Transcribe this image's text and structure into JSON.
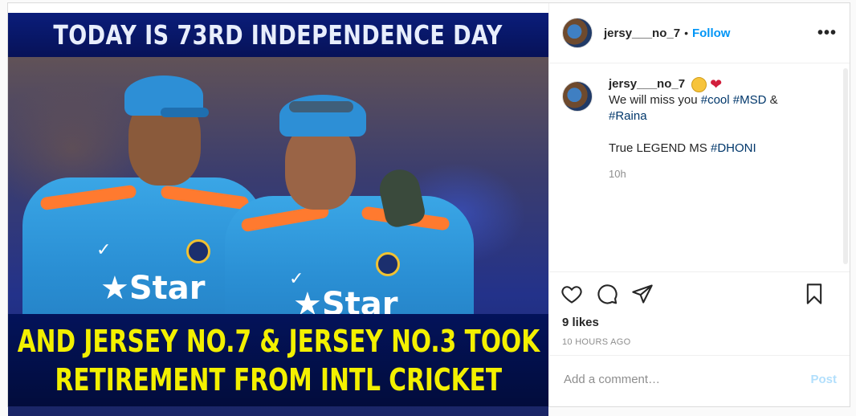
{
  "media": {
    "top_text": "TODAY IS 73RD INDEPENDENCE DAY",
    "bottom_line1": "AND JERSEY NO.7 & JERSEY NO.3 TOOK",
    "bottom_line2": "RETIREMENT FROM INTL CRICKET",
    "jersey_logo": "Star"
  },
  "header": {
    "username": "jersy___no_7",
    "separator": "•",
    "follow_label": "Follow",
    "more_label": "•••"
  },
  "caption": {
    "username": "jersy___no_7",
    "heart": "❤",
    "text_part1": "We will miss you ",
    "tag_cool": "#cool",
    "space": " ",
    "tag_msd": "#MSD",
    "amp": " &",
    "tag_raina": "#Raina",
    "text_part2": "True LEGEND MS ",
    "tag_dhoni": "#DHONI",
    "time": "10h"
  },
  "actions": {
    "icons": [
      "heart-icon",
      "comment-icon",
      "share-icon",
      "bookmark-icon"
    ]
  },
  "likes": "9 likes",
  "timestamp": "10 HOURS AGO",
  "comment_box": {
    "placeholder": "Add a comment…",
    "post_label": "Post"
  },
  "colors": {
    "link": "#0095f6",
    "hashtag": "#00376b",
    "post_disabled": "#b2dffc",
    "banner_text": "#f3f000"
  }
}
